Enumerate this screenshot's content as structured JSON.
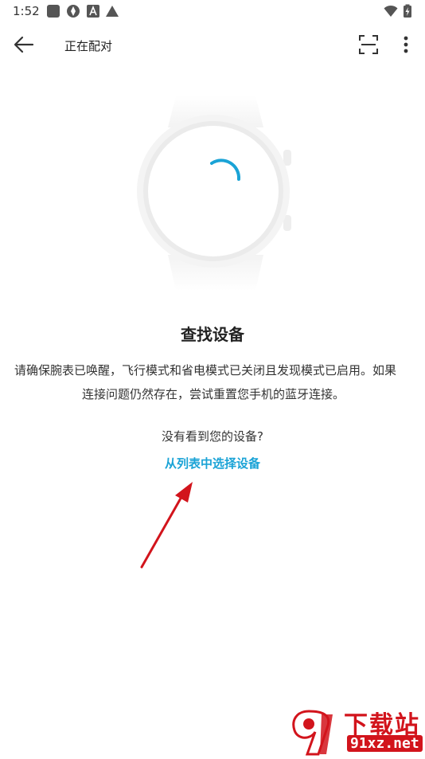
{
  "status_bar": {
    "time": "1:52",
    "icons": [
      "square-app-icon",
      "aperture-icon",
      "font-a-icon",
      "triangle-icon",
      "wifi-icon",
      "battery-charging-icon"
    ]
  },
  "app_bar": {
    "title": "正在配对",
    "back_icon": "arrow-left-icon",
    "scan_icon": "scan-frame-icon",
    "more_icon": "more-vertical-icon"
  },
  "content": {
    "title": "查找设备",
    "description_line1": "请确保腕表已唤醒，飞行模式和省电模式已关闭且发现模式已启用。如果",
    "description_line2": "连接问题仍然存在，尝试重置您手机的蓝牙连接。",
    "not_found_text": "没有看到您的设备?",
    "select_from_list": "从列表中选择设备"
  },
  "colors": {
    "accent": "#1aa3d6",
    "annotation_arrow": "#d2141c",
    "watermark": "#d2141c"
  },
  "watermark": {
    "top": "下载站",
    "bottom": "91xz.net"
  }
}
